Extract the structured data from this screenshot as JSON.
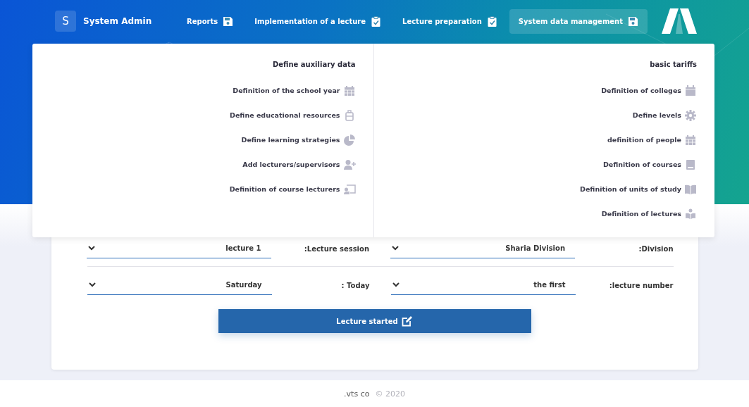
{
  "user": {
    "initial": "S",
    "name": "System Admin"
  },
  "nav": [
    {
      "label": "Reports",
      "selected": false
    },
    {
      "label": "Implementation of a lecture",
      "selected": false
    },
    {
      "label": "Lecture preparation",
      "selected": false
    },
    {
      "label": "System data management",
      "selected": true
    }
  ],
  "menu": {
    "columns": [
      {
        "heading": "Define auxiliary data",
        "items": [
          "Definition of the school year",
          "Define educational resources",
          "Define learning strategies",
          "Add lecturers/supervisors",
          "Definition of course lecturers"
        ]
      },
      {
        "heading": "basic tariffs",
        "items": [
          "Definition of colleges",
          "Define levels",
          "definition of people",
          "Definition of courses",
          "Definition of units of study",
          "Definition of lectures"
        ]
      }
    ]
  },
  "form": {
    "rows": [
      [
        {
          "label": ":Lecture session",
          "selection": "lecture 1"
        },
        {
          "label": ":Division",
          "selection": "Sharia Division"
        }
      ],
      [
        {
          "label": ": Today",
          "selection": "Saturday"
        },
        {
          "label": ":lecture number",
          "selection": "the first"
        }
      ]
    ],
    "button": "Lecture started"
  },
  "footer": {
    "company": ".vts co",
    "copyright": "© 2020"
  }
}
